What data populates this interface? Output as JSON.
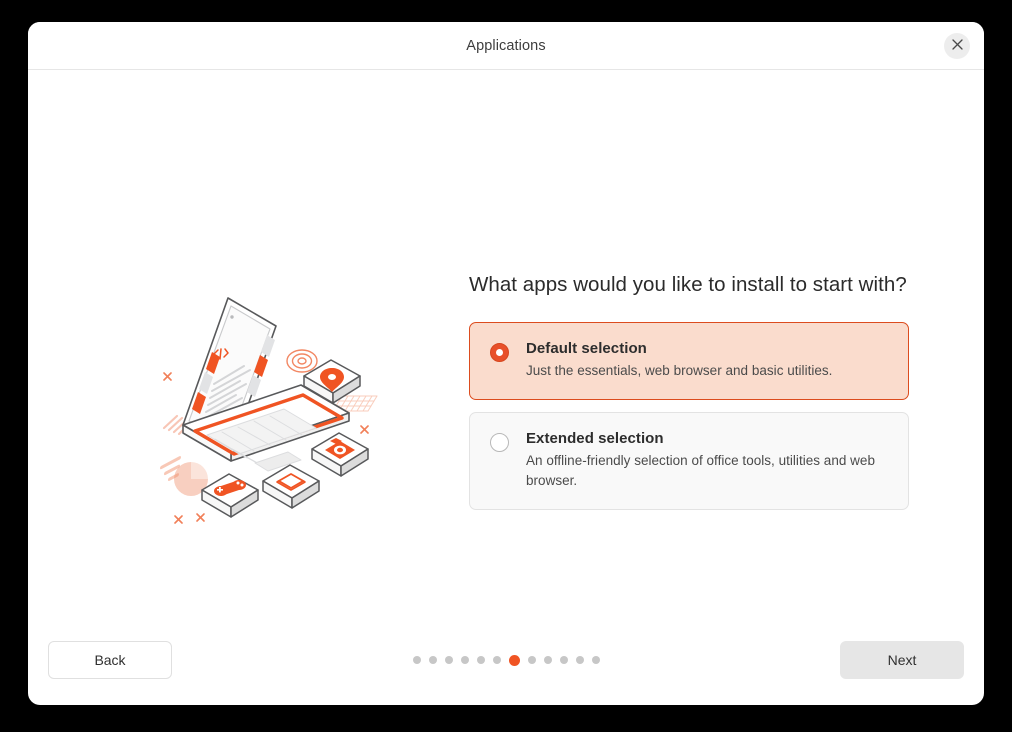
{
  "window": {
    "title": "Applications",
    "close_icon": "close-icon"
  },
  "main": {
    "heading": "What apps would you like to install to start with?",
    "options": [
      {
        "title": "Default selection",
        "description": "Just the essentials, web browser and basic utilities.",
        "selected": true
      },
      {
        "title": "Extended selection",
        "description": "An offline-friendly selection of office tools, utilities and web browser.",
        "selected": false
      }
    ],
    "illustration": "laptop-apps-illustration"
  },
  "footer": {
    "back_label": "Back",
    "next_label": "Next",
    "pagination": {
      "total": 12,
      "active_index": 6
    }
  },
  "colors": {
    "accent": "#e8502a",
    "accent_dot": "#f05423",
    "selected_card_bg": "#fadccd",
    "selected_card_border": "#dc4c1e",
    "unselected_card_bg": "#f9f9f9",
    "unselected_card_border": "#e3e3e3",
    "next_button_bg": "#e6e6e6",
    "backdrop": "#000000",
    "window_bg": "#ffffff"
  }
}
